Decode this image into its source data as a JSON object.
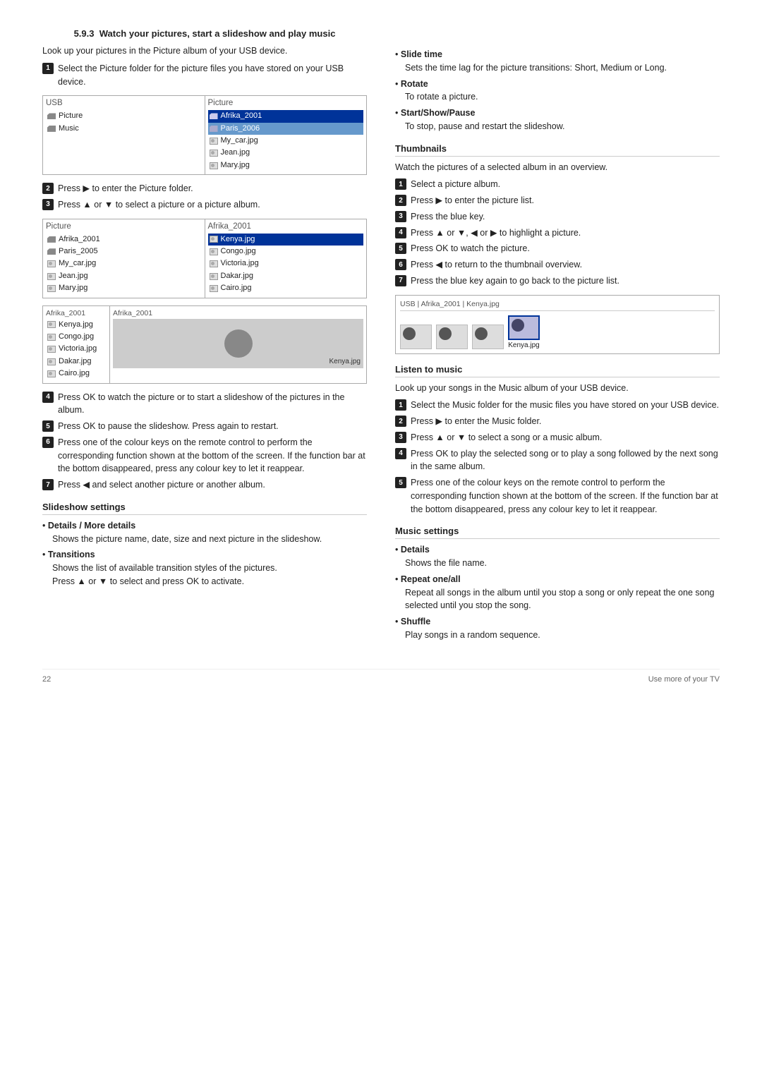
{
  "section": {
    "number": "5.9.3",
    "title": "Watch your pictures, start a slideshow and play music"
  },
  "left_col": {
    "intro": "Look up your pictures in the Picture album of your USB device.",
    "step1_label": "Select the Picture folder for the picture files you have stored on your USB device.",
    "browser1": {
      "left_header": "USB",
      "right_header": "Picture",
      "left_items": [
        {
          "label": "Picture",
          "type": "folder",
          "selected": false
        },
        {
          "label": "Music",
          "type": "folder",
          "selected": false
        }
      ],
      "right_items": [
        {
          "label": "Afrika_2001",
          "type": "folder",
          "selected": true
        },
        {
          "label": "Paris_2006",
          "type": "folder",
          "selected": false
        },
        {
          "label": "My_car.jpg",
          "type": "img",
          "selected": false
        },
        {
          "label": "Jean.jpg",
          "type": "img",
          "selected": false
        },
        {
          "label": "Mary.jpg",
          "type": "img",
          "selected": false
        }
      ]
    },
    "step2": "Press ▶ to enter the Picture folder.",
    "step3": "Press ▲ or ▼ to select a picture or a picture album.",
    "browser2": {
      "left_header": "Picture",
      "right_header": "Afrika_2001",
      "left_items": [
        {
          "label": "Afrika_2001",
          "type": "folder",
          "selected": false
        },
        {
          "label": "Paris_2005",
          "type": "folder",
          "selected": false
        },
        {
          "label": "My_car.jpg",
          "type": "img",
          "selected": false
        },
        {
          "label": "Jean.jpg",
          "type": "img",
          "selected": false
        },
        {
          "label": "Mary.jpg",
          "type": "img",
          "selected": false
        }
      ],
      "right_items": [
        {
          "label": "Kenya.jpg",
          "type": "img",
          "selected": true
        },
        {
          "label": "Congo.jpg",
          "type": "img",
          "selected": false
        },
        {
          "label": "Victoria.jpg",
          "type": "img",
          "selected": false
        },
        {
          "label": "Dakar.jpg",
          "type": "img",
          "selected": false
        },
        {
          "label": "Cairo.jpg",
          "type": "img",
          "selected": false
        }
      ]
    },
    "browser3": {
      "left_header": "Afrika_2001",
      "right_header": "Afrika_2001",
      "left_items": [
        {
          "label": "Kenya.jpg",
          "type": "img",
          "selected": false
        },
        {
          "label": "Congo.jpg",
          "type": "img",
          "selected": false
        },
        {
          "label": "Victoria.jpg",
          "type": "img",
          "selected": false
        },
        {
          "label": "Dakar.jpg",
          "type": "img",
          "selected": false
        },
        {
          "label": "Cairo.jpg",
          "type": "img",
          "selected": false
        }
      ],
      "preview_label": "Kenya.jpg"
    },
    "step4": "Press OK to watch the picture or to start a slideshow of the pictures in the album.",
    "step5": "Press OK to pause the slideshow. Press again to restart.",
    "step6": "Press one of the colour keys on the remote control to perform the corresponding function shown at the bottom of the screen. If the function bar at the bottom disappeared, press any colour key to let it reappear.",
    "step7": "Press ◀ and select another picture or another album.",
    "slideshow_title": "Slideshow settings",
    "slideshow_bullets": [
      {
        "title": "Details / More details",
        "body": "Shows the picture name, date, size and next picture in the slideshow."
      },
      {
        "title": "Transitions",
        "body": "Shows the list of available transition styles of the pictures.",
        "extra": "Press ▲ or ▼ to select and press OK to activate."
      }
    ]
  },
  "right_col": {
    "more_bullets": [
      {
        "title": "Slide time",
        "body": "Sets the time lag for the picture transitions: Short, Medium or Long."
      },
      {
        "title": "Rotate",
        "body": "To rotate a picture."
      },
      {
        "title": "Start/Show/Pause",
        "body": "To stop, pause and restart the slideshow."
      }
    ],
    "thumbnails_title": "Thumbnails",
    "thumbnails_intro": "Watch the pictures of a selected album in an overview.",
    "thumbnails_steps": [
      "Select a picture album.",
      "Press ▶ to enter the picture list.",
      "Press the blue key.",
      "Press ▲ or ▼, ◀ or ▶ to highlight a picture.",
      "Press OK to watch the picture.",
      "Press ◀ to return to the thumbnail overview.",
      "Press the blue key again to go back to the picture list."
    ],
    "preview_browser": {
      "breadcrumb": "USB  |  Afrika_2001  |  Kenya.jpg",
      "thumbs": [
        {
          "label": "",
          "selected": false
        },
        {
          "label": "",
          "selected": false
        },
        {
          "label": "",
          "selected": false
        },
        {
          "label": "Kenya.jpg",
          "selected": true
        }
      ]
    },
    "listen_title": "Listen to music",
    "listen_intro": "Look up your songs in the Music album of your USB device.",
    "listen_steps": [
      "Select the Music folder for the music files you have stored on your USB device.",
      "Press ▶ to enter the Music folder.",
      "Press ▲ or ▼ to select a song or a music album.",
      "Press OK to play the selected song or to play a song followed by the next song in the same album.",
      "Press one of the colour keys on the remote control to perform the corresponding function shown at the bottom of the screen. If the function bar at the bottom disappeared, press any colour key to let it reappear."
    ],
    "music_settings_title": "Music settings",
    "music_bullets": [
      {
        "title": "Details",
        "body": "Shows the file name."
      },
      {
        "title": "Repeat one/all",
        "body": "Repeat all songs in the album until you stop a song or only repeat the one song selected until you stop the song."
      },
      {
        "title": "Shuffle",
        "body": "Play songs in a random sequence."
      }
    ]
  },
  "footer": {
    "page_number": "22",
    "right_text": "Use more of your TV"
  }
}
